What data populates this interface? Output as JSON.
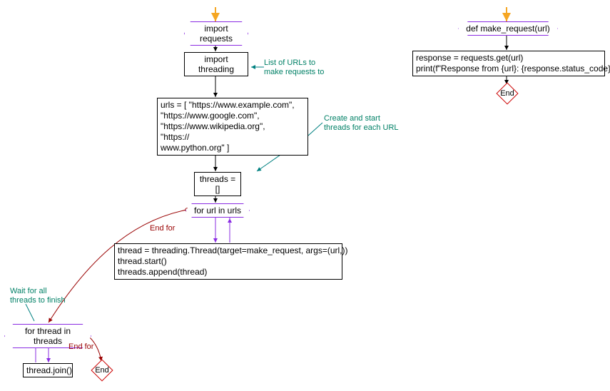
{
  "chart_data": {
    "type": "flowchart",
    "title": "",
    "left_flow": {
      "start": "start",
      "steps": [
        {
          "id": "import_requests",
          "shape": "hex",
          "text": "import requests"
        },
        {
          "id": "import_threading",
          "shape": "rect",
          "text": "import threading",
          "annotation": "List of URLs to make requests to"
        },
        {
          "id": "urls_list",
          "shape": "rect",
          "text": "urls = [ \"https://www.example.com\",\n\"https://www.google.com\",\n\"https://www.wikipedia.org\",\n\"https://\nwww.python.org\" ]",
          "annotation": "Create and start threads for each URL"
        },
        {
          "id": "threads_init",
          "shape": "rect",
          "text": "threads = []"
        },
        {
          "id": "for_url",
          "shape": "hex",
          "text": "for url in urls",
          "loop_end_label": "End for"
        },
        {
          "id": "thread_body",
          "shape": "rect",
          "text": "thread = threading.Thread(target=make_request, args=(url,))\nthread.start()\nthreads.append(thread)"
        },
        {
          "id": "for_thread",
          "shape": "hex",
          "text": "for thread in threads",
          "annotation": "Wait for all threads to finish",
          "loop_end_label": "End for"
        },
        {
          "id": "thread_join",
          "shape": "rect",
          "text": "thread.join()"
        },
        {
          "id": "end1",
          "shape": "diamond",
          "text": "End"
        }
      ]
    },
    "right_flow": {
      "start": "start",
      "steps": [
        {
          "id": "def_make_request",
          "shape": "hex",
          "text": "def make_request(url)"
        },
        {
          "id": "func_body",
          "shape": "rect",
          "text": "response = requests.get(url)\nprint(f\"Response from {url}: {response.status_code}\")"
        },
        {
          "id": "end2",
          "shape": "diamond",
          "text": "End"
        }
      ]
    }
  },
  "left": {
    "import_requests": "import requests",
    "import_threading": "import threading",
    "anno_urls": "List of URLs to\nmake requests to",
    "urls_list": "urls = [ \"https://www.example.com\",\n\"https://www.google.com\",\n\"https://www.wikipedia.org\",\n\"https://\nwww.python.org\" ]",
    "anno_threads": "Create and start\nthreads for each URL",
    "threads_init": "threads = []",
    "for_url": "for url in urls",
    "end_for1": "End for",
    "thread_body": "thread = threading.Thread(target=make_request, args=(url,))\nthread.start()\nthreads.append(thread)",
    "anno_wait": "Wait for all\nthreads to finish",
    "for_thread": "for thread in threads",
    "end_for2": "End for",
    "thread_join": "thread.join()",
    "end1": "End"
  },
  "right": {
    "def_make_request": "def make_request(url)",
    "func_body": "response = requests.get(url)\nprint(f\"Response from {url}: {response.status_code}\")",
    "end2": "End"
  }
}
